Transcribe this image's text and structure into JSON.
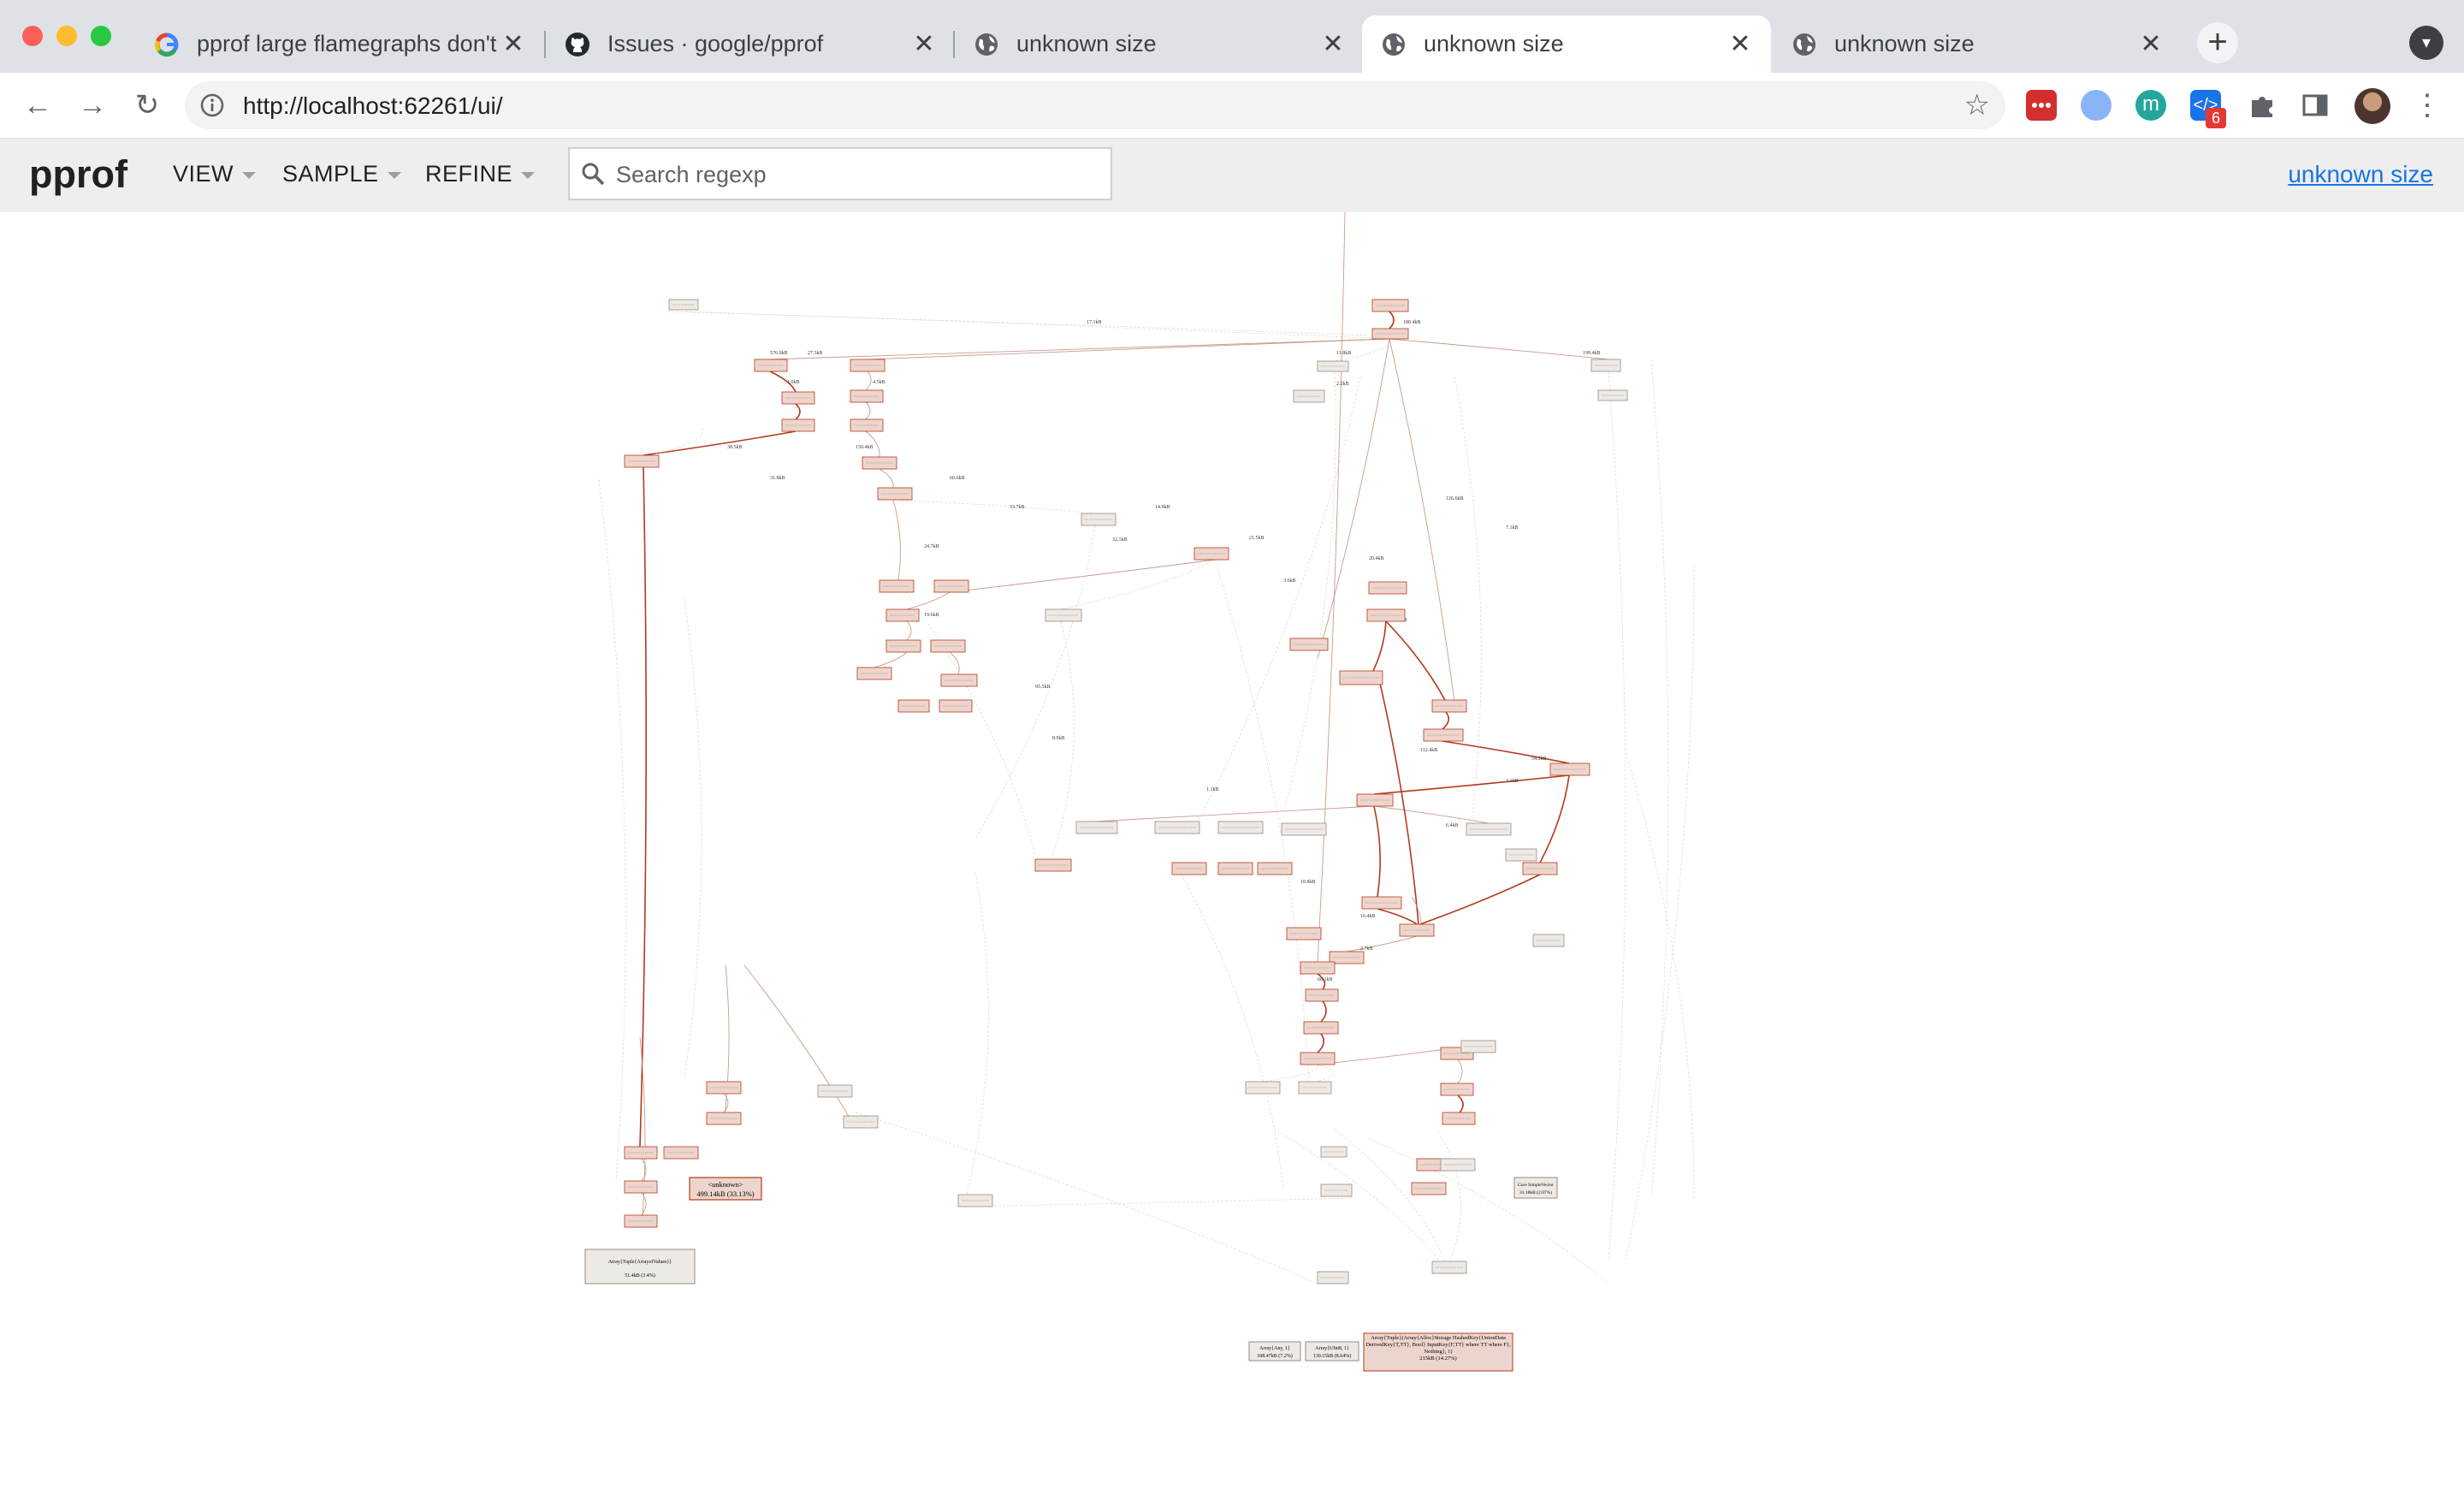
{
  "browser": {
    "tabs": [
      {
        "title": "pprof large flamegraphs don't r",
        "favicon": "google-icon",
        "active": false
      },
      {
        "title": "Issues · google/pprof",
        "favicon": "github-icon",
        "active": false
      },
      {
        "title": "unknown size",
        "favicon": "globe-icon",
        "active": false
      },
      {
        "title": "unknown size",
        "favicon": "globe-icon",
        "active": true
      },
      {
        "title": "unknown size",
        "favicon": "globe-icon",
        "active": false
      }
    ],
    "close_glyph": "✕",
    "new_tab_glyph": "+",
    "url": "http://localhost:62261/ui/",
    "extension_badge": "6"
  },
  "pprof": {
    "logo": "pprof",
    "menus": [
      "VIEW",
      "SAMPLE",
      "REFINE"
    ],
    "search_placeholder": "Search regexp",
    "search_value": "",
    "profile_link": "unknown size"
  },
  "graph": {
    "edge_labels": [
      "17.1kB",
      "180.4kB",
      "576.0kB",
      "27.3kB",
      "44.8kB",
      "11.8kB",
      "199.4kB",
      "1.0kB",
      "4.5kB",
      "2.2kB",
      "38.5kB",
      "150.4kB",
      "31.8kB",
      "60.6kB",
      "33.7kB",
      "14.9kB",
      "21.5kB",
      "32.1kB",
      "24.7kB",
      "20.4kB",
      "126.6kB",
      "7.1kB",
      "3.6kB",
      "9.6kB",
      "19.6kB",
      "95.5kB",
      "8.9kB",
      "112.4kB",
      "54.2kB",
      "3.1kB",
      "1.1kB",
      "6.4kB",
      "10.8kB",
      "16.4kB",
      "2.7kB",
      "66.1kB"
    ],
    "nodes": [
      {
        "label": "<unknown>",
        "value": "499.14kB (33.13%)"
      },
      {
        "label": "Array{Tuple{ArrayofValues}}",
        "value": "51.4kB (3.4%)"
      },
      {
        "label": "Array{Tuple}(Array{Alloc}Storage HashedKey{UnionData DerivedKey{T,TT}, Bool} InputKey{F,TT} where TT where F}, Nothing}, 1)",
        "value": "215kB (14.27%)"
      },
      {
        "label": "Array{Any, 1}",
        "value": "108.47kB (7.2%)"
      },
      {
        "label": "Array{UInt8, 1}",
        "value": "130.15kB (8.64%)"
      },
      {
        "label": "Core SimpleVector",
        "value": "31.18kB (2.07%)"
      }
    ]
  },
  "colors": {
    "tabstrip": "#dee1e6",
    "pprof_header": "#eeeeee",
    "hot_edge": "#b23a1b",
    "hot_node_fill": "#edd5cd",
    "cold_node_fill": "#ede9e4",
    "link": "#1a73e8"
  }
}
